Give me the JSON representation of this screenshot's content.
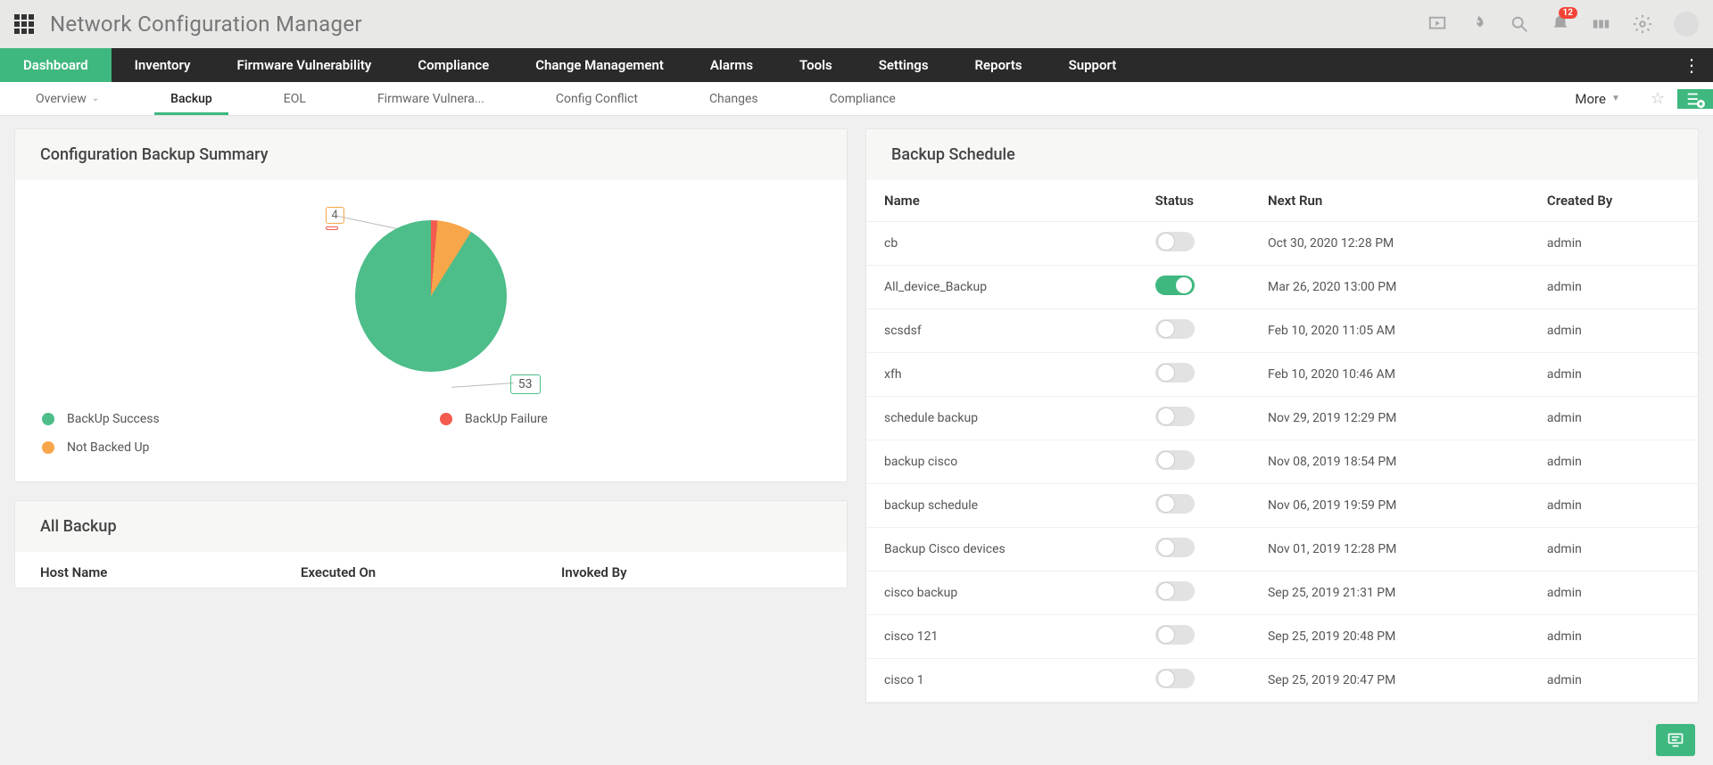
{
  "app_title": "Network Configuration Manager",
  "notification_count": "12",
  "main_nav": [
    "Dashboard",
    "Inventory",
    "Firmware Vulnerability",
    "Compliance",
    "Change Management",
    "Alarms",
    "Tools",
    "Settings",
    "Reports",
    "Support"
  ],
  "sub_nav": {
    "items": [
      "Overview",
      "Backup",
      "EOL",
      "Firmware Vulnera...",
      "Config Conflict",
      "Changes",
      "Compliance"
    ],
    "more": "More"
  },
  "left_panel": {
    "title": "Configuration Backup Summary",
    "callout_top": "4",
    "callout_bottom": "53",
    "legend": [
      {
        "label": "BackUp Success",
        "color": "#4dbd8a"
      },
      {
        "label": "BackUp Failure",
        "color": "#f35b4e"
      },
      {
        "label": "Not Backed Up",
        "color": "#f7a64a"
      }
    ]
  },
  "all_backup": {
    "title": "All Backup",
    "cols": [
      "Host Name",
      "Executed On",
      "Invoked By"
    ]
  },
  "right_panel": {
    "title": "Backup Schedule",
    "cols": [
      "Name",
      "Status",
      "Next Run",
      "Created By"
    ],
    "rows": [
      {
        "name": "cb",
        "on": false,
        "next": "Oct 30, 2020 12:28 PM",
        "by": "admin"
      },
      {
        "name": "All_device_Backup",
        "on": true,
        "next": "Mar 26, 2020 13:00 PM",
        "by": "admin"
      },
      {
        "name": "scsdsf",
        "on": false,
        "next": "Feb 10, 2020 11:05 AM",
        "by": "admin"
      },
      {
        "name": "xfh",
        "on": false,
        "next": "Feb 10, 2020 10:46 AM",
        "by": "admin"
      },
      {
        "name": "schedule backup",
        "on": false,
        "next": "Nov 29, 2019 12:29 PM",
        "by": "admin"
      },
      {
        "name": "backup cisco",
        "on": false,
        "next": "Nov 08, 2019 18:54 PM",
        "by": "admin"
      },
      {
        "name": "backup schedule",
        "on": false,
        "next": "Nov 06, 2019 19:59 PM",
        "by": "admin"
      },
      {
        "name": "Backup Cisco devices",
        "on": false,
        "next": "Nov 01, 2019 12:28 PM",
        "by": "admin"
      },
      {
        "name": "cisco backup",
        "on": false,
        "next": "Sep 25, 2019 21:31 PM",
        "by": "admin"
      },
      {
        "name": "cisco 121",
        "on": false,
        "next": "Sep 25, 2019 20:48 PM",
        "by": "admin"
      },
      {
        "name": "cisco 1",
        "on": false,
        "next": "Sep 25, 2019 20:47 PM",
        "by": "admin"
      }
    ]
  },
  "chart_data": {
    "type": "pie",
    "title": "Configuration Backup Summary",
    "series": [
      {
        "name": "BackUp Success",
        "value": 53,
        "color": "#4dbd8a"
      },
      {
        "name": "BackUp Failure",
        "value": 1,
        "color": "#f35b4e"
      },
      {
        "name": "Not Backed Up",
        "value": 4,
        "color": "#f7a64a"
      }
    ]
  }
}
